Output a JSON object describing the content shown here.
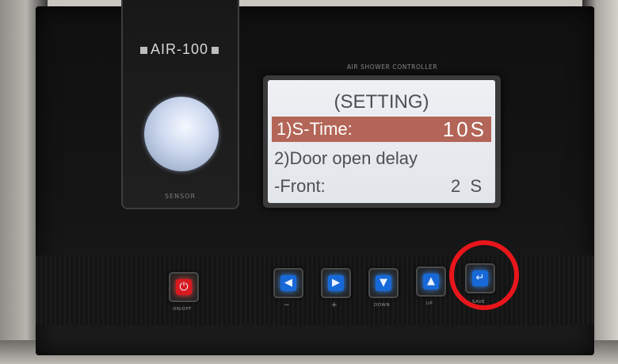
{
  "device": {
    "model": "AIR-100",
    "sensor_label": "SENSOR",
    "controller_title": "AIR SHOWER CONTROLLER"
  },
  "display": {
    "title": "(SETTING)",
    "rows": [
      {
        "label": "1)S-Time:",
        "value": "10S",
        "selected": true
      },
      {
        "label": "2)Door open delay",
        "value": ""
      },
      {
        "label": "-Front:",
        "value": "2 S"
      }
    ],
    "highlight_color": "#b36557"
  },
  "buttons": [
    {
      "name": "power",
      "icon": "power-icon",
      "glyph": "⏻",
      "caption": "ON/OFF"
    },
    {
      "name": "left",
      "icon": "triangle-left-icon",
      "glyph": "◀",
      "caption": "−"
    },
    {
      "name": "right",
      "icon": "triangle-right-icon",
      "glyph": "▶",
      "caption": "+"
    },
    {
      "name": "down",
      "icon": "triangle-down-icon",
      "glyph": "▼",
      "caption": "DOWN"
    },
    {
      "name": "up",
      "icon": "triangle-up-icon",
      "glyph": "▲",
      "caption": "UP"
    },
    {
      "name": "save",
      "icon": "enter-return-icon",
      "glyph": "↵",
      "caption": "SAVE"
    }
  ],
  "colors": {
    "button_glow": "#1769d8",
    "power_glow": "#d8191f",
    "annotation_ring": "#e8161b"
  }
}
